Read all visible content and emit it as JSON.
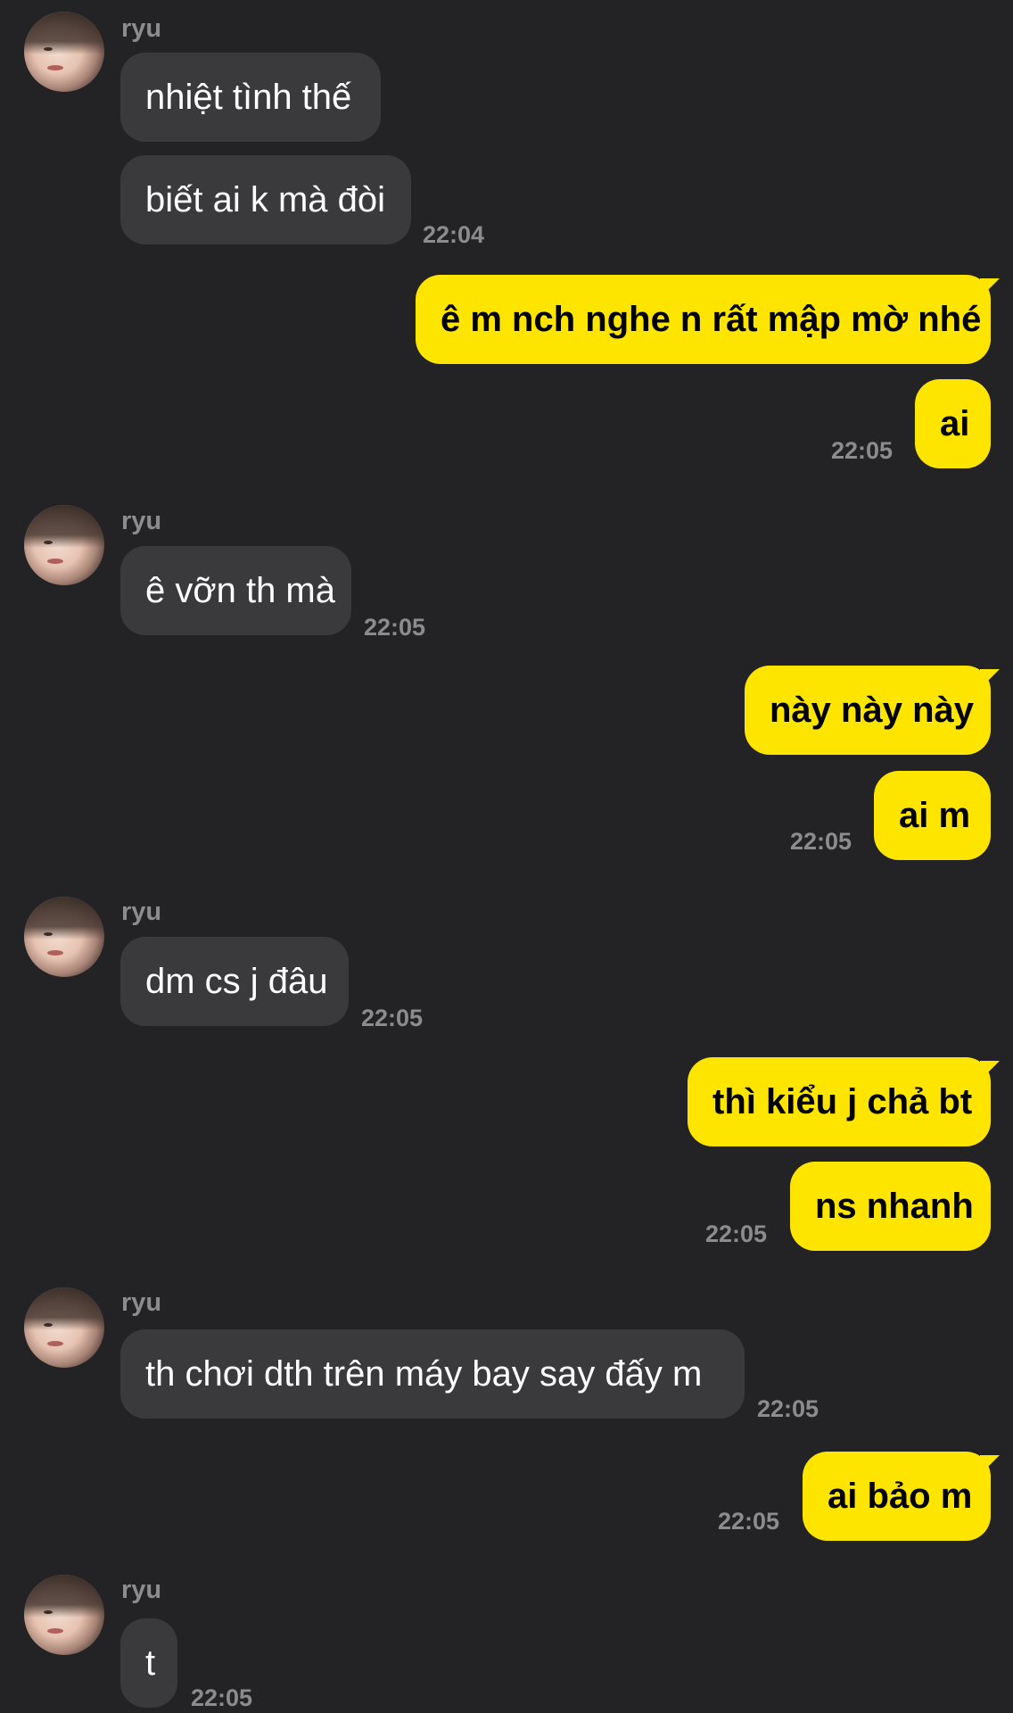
{
  "contact": {
    "name": "ryu"
  },
  "messages": [
    {
      "sender": "ryu",
      "text": "nhiệt tình thế"
    },
    {
      "sender": "ryu",
      "text": "biết ai k mà đòi",
      "time": "22:04"
    },
    {
      "sender": "me",
      "text": "ê m nch nghe n rất mập mờ nhé"
    },
    {
      "sender": "me",
      "text": "ai",
      "time": "22:05"
    },
    {
      "sender": "ryu",
      "text": "ê vỡn th mà",
      "time": "22:05"
    },
    {
      "sender": "me",
      "text": "này này này"
    },
    {
      "sender": "me",
      "text": "ai m",
      "time": "22:05"
    },
    {
      "sender": "ryu",
      "text": "dm cs j đâu",
      "time": "22:05"
    },
    {
      "sender": "me",
      "text": "thì kiểu j chả bt"
    },
    {
      "sender": "me",
      "text": "ns nhanh",
      "time": "22:05"
    },
    {
      "sender": "ryu",
      "text": "th chơi dth trên máy bay say đấy m",
      "time": "22:05"
    },
    {
      "sender": "me",
      "text": "ai bảo m",
      "time": "22:05"
    },
    {
      "sender": "ryu",
      "text": "t",
      "time": "22:05"
    }
  ],
  "colors": {
    "background": "#232325",
    "incoming_bubble": "#3a3a3c",
    "outgoing_bubble": "#fde500",
    "timestamp": "#8c8c90"
  }
}
